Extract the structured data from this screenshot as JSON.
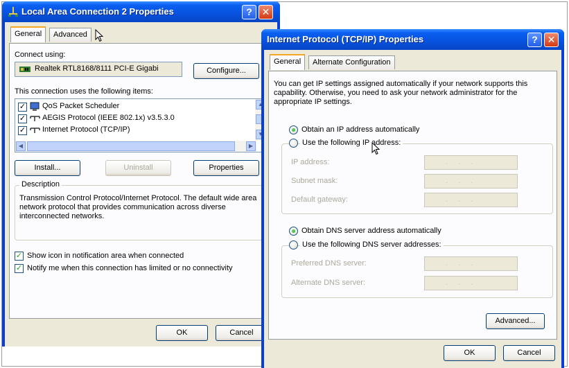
{
  "lan_dialog": {
    "title": "Local Area Connection 2 Properties",
    "tabs": [
      "General",
      "Advanced"
    ],
    "connect_using_label": "Connect using:",
    "adapter_name": "Realtek RTL8168/8111 PCI-E Gigabi",
    "configure_label": "Configure...",
    "items_label": "This connection uses the following items:",
    "items": [
      {
        "label": "QoS Packet Scheduler",
        "checked": true,
        "icon": "qos-icon"
      },
      {
        "label": "AEGIS Protocol (IEEE 802.1x) v3.5.3.0",
        "checked": true,
        "icon": "protocol-icon"
      },
      {
        "label": "Internet Protocol (TCP/IP)",
        "checked": true,
        "icon": "protocol-icon"
      }
    ],
    "install_label": "Install...",
    "uninstall_label": "Uninstall",
    "properties_label": "Properties",
    "description_title": "Description",
    "description_text": "Transmission Control Protocol/Internet Protocol. The default wide area network protocol that provides communication across diverse interconnected networks.",
    "show_icon_label": "Show icon in notification area when connected",
    "notify_label": "Notify me when this connection has limited or no connectivity",
    "ok_label": "OK",
    "cancel_label": "Cancel"
  },
  "tcpip_dialog": {
    "title": "Internet Protocol (TCP/IP) Properties",
    "tabs": [
      "General",
      "Alternate Configuration"
    ],
    "intro_text": "You can get IP settings assigned automatically if your network supports this capability. Otherwise, you need to ask your network administrator for the appropriate IP settings.",
    "obtain_ip_label": "Obtain an IP address automatically",
    "use_ip_label": "Use the following IP address:",
    "ip_address_label": "IP address:",
    "subnet_mask_label": "Subnet mask:",
    "default_gateway_label": "Default gateway:",
    "obtain_dns_label": "Obtain DNS server address automatically",
    "use_dns_label": "Use the following DNS server addresses:",
    "preferred_dns_label": "Preferred DNS server:",
    "alternate_dns_label": "Alternate DNS server:",
    "advanced_label": "Advanced...",
    "ok_label": "OK",
    "cancel_label": "Cancel"
  },
  "colors": {
    "titlebar": "#0853e0",
    "dialog_face": "#ece9d8",
    "tab_highlight": "#f5a623"
  }
}
